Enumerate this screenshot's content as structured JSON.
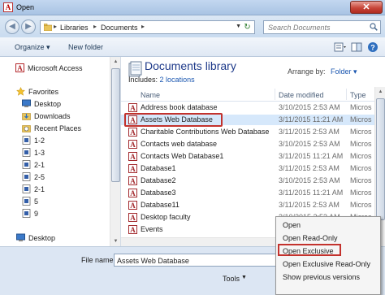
{
  "window": {
    "title": "Open"
  },
  "address": {
    "segments": [
      "Libraries",
      "Documents"
    ],
    "search_placeholder": "Search Documents"
  },
  "toolbar": {
    "organize_label": "Organize ▾",
    "new_folder_label": "New folder"
  },
  "nav": {
    "app_item": "Microsoft Access",
    "favorites_header": "Favorites",
    "favorites": [
      "Desktop",
      "Downloads",
      "Recent Places"
    ],
    "folders": [
      "1-2",
      "1-3",
      "2-1",
      "2-5",
      "2-1",
      "5",
      "9"
    ],
    "desktop_item": "Desktop"
  },
  "library": {
    "title": "Documents library",
    "includes_label": "Includes:",
    "includes_link": "2 locations",
    "arrange_label": "Arrange by:",
    "arrange_value": "Folder ▾"
  },
  "columns": {
    "name": "Name",
    "date": "Date modified",
    "type": "Type"
  },
  "files": [
    {
      "name": "Address book database",
      "date": "3/10/2015 2:53 AM",
      "type": "Micros"
    },
    {
      "name": "Assets Web Database",
      "date": "3/11/2015 11:21 AM",
      "type": "Micros",
      "selected": true
    },
    {
      "name": "Charitable Contributions Web Database",
      "date": "3/11/2015 2:53 AM",
      "type": "Micros"
    },
    {
      "name": "Contacts web database",
      "date": "3/10/2015 2:53 AM",
      "type": "Micros"
    },
    {
      "name": "Contacts Web Database1",
      "date": "3/11/2015 11:21 AM",
      "type": "Micros"
    },
    {
      "name": "Database1",
      "date": "3/11/2015 2:53 AM",
      "type": "Micros"
    },
    {
      "name": "Database2",
      "date": "3/10/2015 2:53 AM",
      "type": "Micros"
    },
    {
      "name": "Database3",
      "date": "3/11/2015 11:21 AM",
      "type": "Micros"
    },
    {
      "name": "Database11",
      "date": "3/11/2015 2:53 AM",
      "type": "Micros"
    },
    {
      "name": "Desktop faculty",
      "date": "3/10/2015 2:53 AM",
      "type": "Micros"
    },
    {
      "name": "Events",
      "date": "",
      "type": ""
    }
  ],
  "bottom": {
    "file_name_label": "File name:",
    "file_name_value": "Assets Web Database",
    "tools_label": "Tools"
  },
  "open_menu": {
    "items": [
      "Open",
      "Open Read-Only",
      "Open Exclusive",
      "Open Exclusive Read-Only",
      "Show previous versions"
    ],
    "highlighted": "Open Exclusive"
  },
  "colors": {
    "highlight_box": "#c3322d",
    "link": "#1a56b0",
    "title": "#1e3a8a"
  }
}
